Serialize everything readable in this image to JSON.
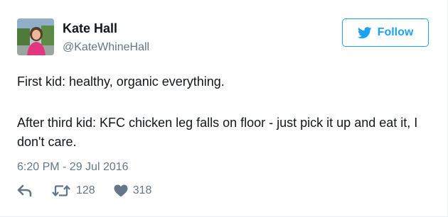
{
  "tweet": {
    "author_name": "Kate Hall",
    "author_handle": "@KateWhineHall",
    "follow_label": "Follow",
    "text_line1": "First kid: healthy, organic everything.",
    "text_line2": "After third kid: KFC chicken leg falls on floor - just pick it up and eat it, I don't care.",
    "timestamp": "6:20 PM - 29 Jul 2016",
    "retweet_count": "128",
    "like_count": "318"
  },
  "icons": {
    "follow": "twitter-bird-icon",
    "reply": "reply-icon",
    "retweet": "retweet-icon",
    "like": "heart-icon"
  },
  "colors": {
    "accent": "#1da1f2",
    "secondary_text": "#657786",
    "primary_text": "#14171a"
  }
}
